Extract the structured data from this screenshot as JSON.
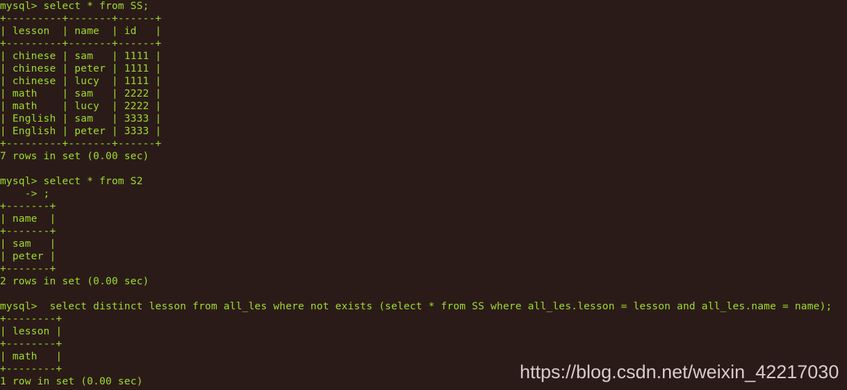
{
  "terminal": {
    "background_color": "#2b1b18",
    "text_color": "#9ddd2c",
    "prompt": "mysql>",
    "continuation_prompt": "->",
    "lines": [
      "mysql> select * from SS;",
      "+---------+-------+------+",
      "| lesson  | name  | id   |",
      "+---------+-------+------+",
      "| chinese | sam   | 1111 |",
      "| chinese | peter | 1111 |",
      "| chinese | lucy  | 1111 |",
      "| math    | sam   | 2222 |",
      "| math    | lucy  | 2222 |",
      "| English | sam   | 3333 |",
      "| English | peter | 3333 |",
      "+---------+-------+------+",
      "7 rows in set (0.00 sec)",
      "",
      "mysql> select * from S2",
      "    -> ;",
      "+-------+",
      "| name  |",
      "+-------+",
      "| sam   |",
      "| peter |",
      "+-------+",
      "2 rows in set (0.00 sec)",
      "",
      "mysql>  select distinct lesson from all_les where not exists (select * from SS where all_les.lesson = lesson and all_les.name = name);",
      "+--------+",
      "| lesson |",
      "+--------+",
      "| math   |",
      "+--------+",
      "1 row in set (0.00 sec)"
    ],
    "commands": [
      {
        "sql": "select * from SS;",
        "columns": [
          "lesson",
          "name",
          "id"
        ],
        "rows": [
          [
            "chinese",
            "sam",
            "1111"
          ],
          [
            "chinese",
            "peter",
            "1111"
          ],
          [
            "chinese",
            "lucy",
            "1111"
          ],
          [
            "math",
            "sam",
            "2222"
          ],
          [
            "math",
            "lucy",
            "2222"
          ],
          [
            "English",
            "sam",
            "3333"
          ],
          [
            "English",
            "peter",
            "3333"
          ]
        ],
        "status": "7 rows in set (0.00 sec)"
      },
      {
        "sql": "select * from S2",
        "continuation": ";",
        "columns": [
          "name"
        ],
        "rows": [
          [
            "sam"
          ],
          [
            "peter"
          ]
        ],
        "status": "2 rows in set (0.00 sec)"
      },
      {
        "sql": "select distinct lesson from all_les where not exists (select * from SS where all_les.lesson = lesson and all_les.name = name);",
        "columns": [
          "lesson"
        ],
        "rows": [
          [
            "math"
          ]
        ],
        "status": "1 row in set (0.00 sec)"
      }
    ]
  },
  "watermark": {
    "text": "https://blog.csdn.net/weixin_42217030",
    "color": "#d6cdcb"
  }
}
